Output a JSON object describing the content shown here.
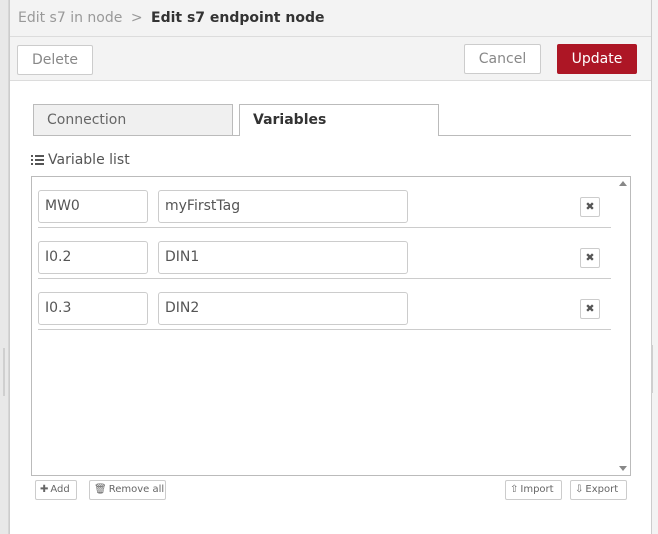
{
  "header": {
    "parent_crumb": "Edit s7 in node",
    "separator": ">",
    "title": "Edit s7 endpoint node"
  },
  "toolbar": {
    "delete_label": "Delete",
    "cancel_label": "Cancel",
    "update_label": "Update"
  },
  "tabs": [
    {
      "label": "Connection",
      "active": false
    },
    {
      "label": "Variables",
      "active": true
    }
  ],
  "variable_list": {
    "label": "Variable list",
    "rows": [
      {
        "address": "MW0",
        "name": "myFirstTag",
        "remove_glyph": "✖"
      },
      {
        "address": "I0.2",
        "name": "DIN1",
        "remove_glyph": "✖"
      },
      {
        "address": "I0.3",
        "name": "DIN2",
        "remove_glyph": "✖"
      }
    ]
  },
  "actions": {
    "add_label": "Add",
    "remove_all_label": "Remove all",
    "import_label": "Import",
    "export_label": "Export"
  },
  "colors": {
    "update_button": "#ad1625",
    "tray_header_bg": "#f3f3f3"
  },
  "icons": {
    "list": "list-icon",
    "add": "plus-icon",
    "remove_all": "trash-icon",
    "import": "upload-icon",
    "export": "download-icon",
    "remove_row": "close-icon"
  }
}
